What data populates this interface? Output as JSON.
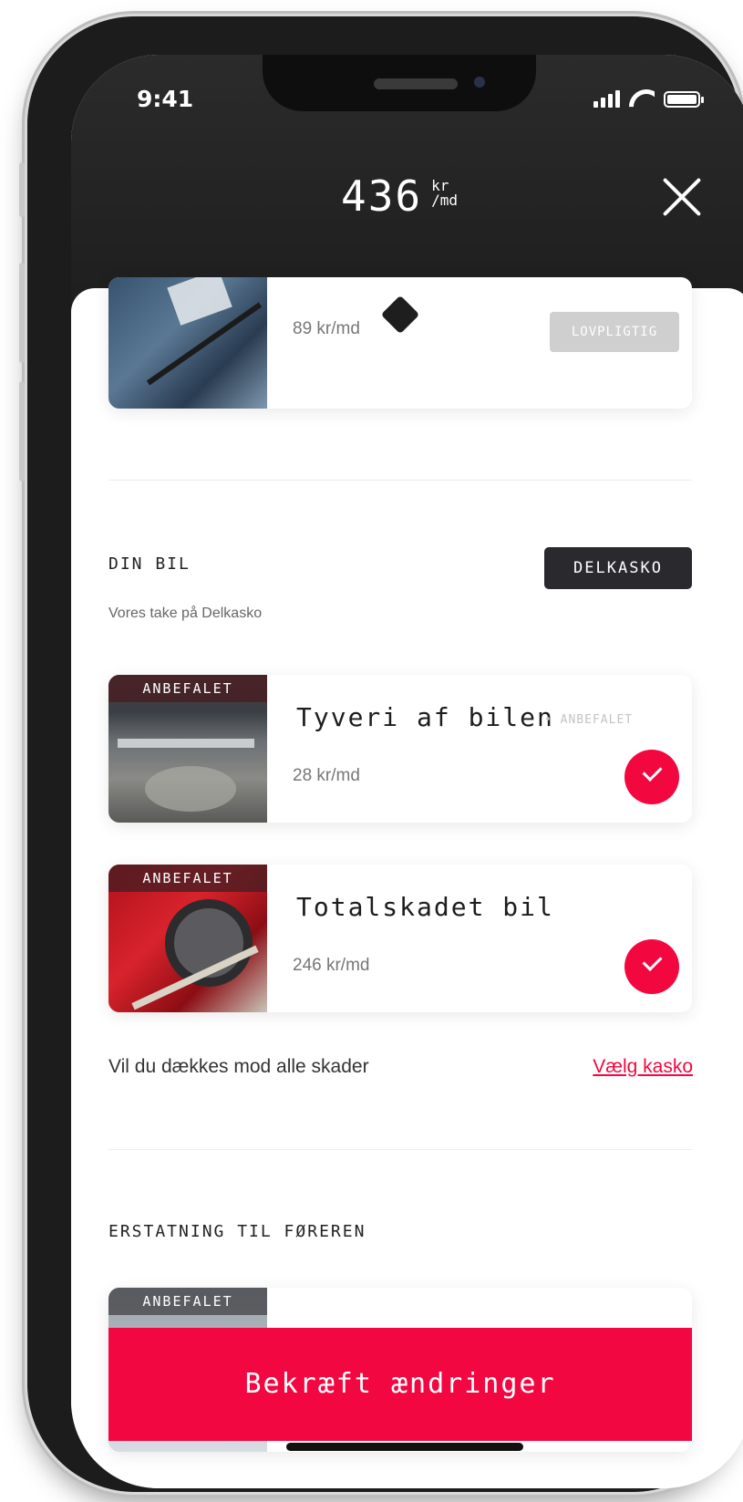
{
  "status_bar": {
    "time": "9:41"
  },
  "header": {
    "price": "436",
    "price_unit_top": "kr",
    "price_unit_bottom": "/md"
  },
  "mandatory_card": {
    "price": "89 kr/md",
    "badge": "LOVPLIGTIG"
  },
  "car_section": {
    "title": "DIN BIL",
    "plan_badge": "DELKASKO",
    "subtitle": "Vores take på Delkasko",
    "cards": [
      {
        "tag": "ANBEFALET",
        "title": "Tyveri af bilen",
        "note": "• ANBEFALET",
        "price": "28 kr/md",
        "selected": true
      },
      {
        "tag": "ANBEFALET",
        "title": "Totalskadet bil",
        "price": "246 kr/md",
        "selected": true
      }
    ],
    "upsell_text": "Vil du dækkes mod alle skader",
    "upsell_link": "Vælg kasko"
  },
  "driver_section": {
    "title": "ERSTATNING TIL FØREREN",
    "card_tag": "ANBEFALET"
  },
  "cta": {
    "label": "Bekræft ændringer"
  },
  "colors": {
    "accent": "#f20741",
    "header_bg": "#1e1e1e",
    "dark_badge": "#2a2a2e"
  }
}
